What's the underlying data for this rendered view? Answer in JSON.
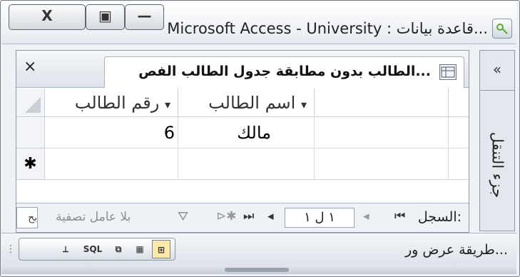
{
  "window": {
    "title": "Microsoft Access - University : قاعدة بيانات...",
    "close_glyph": "X",
    "restore_glyph": "▣",
    "minimize_glyph": "—"
  },
  "nav_pane": {
    "chevron": "«",
    "label": "جزء التنقل"
  },
  "tab": {
    "title": "الطالب بدون مطابقة جدول الطالب الفص...",
    "close_glyph": "×"
  },
  "grid": {
    "columns": [
      "اسم الطالب",
      "رقم الطالب"
    ],
    "dropdown_glyph": "▾",
    "rows": [
      {
        "name": "مالك",
        "id": "6"
      }
    ],
    "new_row_marker": "✱"
  },
  "record_nav": {
    "label": "السجل:",
    "first_glyph": "⏮",
    "prev_glyph": "◂",
    "current": "١ ل ١",
    "next_glyph": "◂",
    "last_glyph": "⏭",
    "new_glyph": "⊳✱",
    "filter_text": "بلا عامل تصفية",
    "filter_icon": "⛛",
    "search_stub": "بح"
  },
  "status_bar": {
    "text": "طريقة عرض ور...",
    "view_buttons": [
      "⊞",
      "▦",
      "⧉",
      "SQL",
      "⟂"
    ],
    "grip": "⋮⋮"
  }
}
